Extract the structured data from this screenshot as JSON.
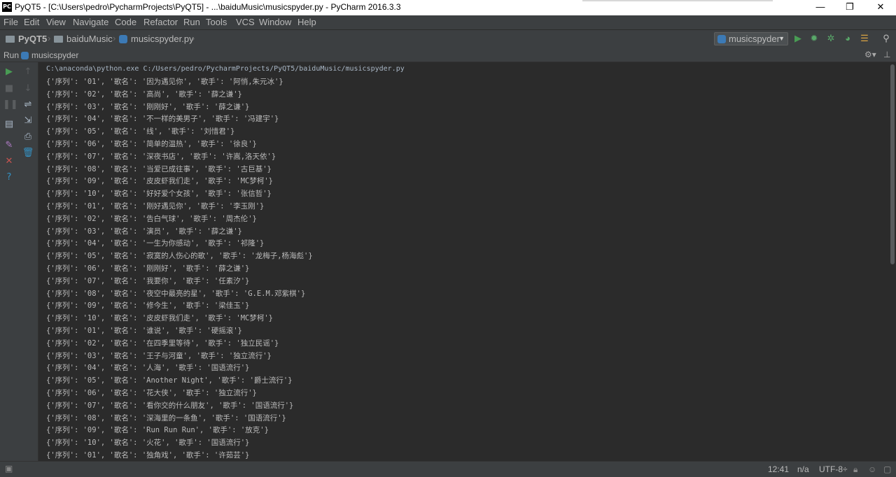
{
  "window": {
    "title": "PyQT5 - [C:\\Users\\pedro\\PycharmProjects\\PyQT5] - ...\\baiduMusic\\musicspyder.py - PyCharm 2016.3.3",
    "app_icon_text": "PC",
    "minimize": "—",
    "restore": "❐",
    "close": "✕"
  },
  "menu": [
    "File",
    "Edit",
    "View",
    "Navigate",
    "Code",
    "Refactor",
    "Run",
    "Tools",
    "VCS",
    "Window",
    "Help"
  ],
  "breadcrumb": {
    "project": "PyQT5",
    "folder": "baiduMusic",
    "file": "musicspyder.py"
  },
  "run_config": "musicspyder",
  "run_panel": {
    "label": "Run",
    "tab": "musicspyder"
  },
  "console": {
    "command": "C:\\anaconda\\python.exe C:/Users/pedro/PycharmProjects/PyQT5/baiduMusic/musicspyder.py",
    "lines": [
      "{'序列': '01', '歌名': '因为遇见你', '歌手': '阿悄,朱元冰'}",
      "{'序列': '02', '歌名': '高尚', '歌手': '薛之谦'}",
      "{'序列': '03', '歌名': '刚刚好', '歌手': '薛之谦'}",
      "{'序列': '04', '歌名': '不一样的美男子', '歌手': '冯建宇'}",
      "{'序列': '05', '歌名': '线', '歌手': '刘惜君'}",
      "{'序列': '06', '歌名': '简单的温热', '歌手': '徐良'}",
      "{'序列': '07', '歌名': '深夜书店', '歌手': '许嵩,洛天依'}",
      "{'序列': '08', '歌名': '当爱已成往事', '歌手': '古巨基'}",
      "{'序列': '09', '歌名': '皮皮虾我们走', '歌手': 'MC梦柯'}",
      "{'序列': '10', '歌名': '好好爱个女孩', '歌手': '张信哲'}",
      "{'序列': '01', '歌名': '刚好遇见你', '歌手': '李玉刚'}",
      "{'序列': '02', '歌名': '告白气球', '歌手': '周杰伦'}",
      "{'序列': '03', '歌名': '演员', '歌手': '薛之谦'}",
      "{'序列': '04', '歌名': '一生为你感动', '歌手': '祁隆'}",
      "{'序列': '05', '歌名': '寂寞的人伤心的歌', '歌手': '龙梅子,杨海彪'}",
      "{'序列': '06', '歌名': '刚刚好', '歌手': '薛之谦'}",
      "{'序列': '07', '歌名': '我要你', '歌手': '任素汐'}",
      "{'序列': '08', '歌名': '夜空中最亮的星', '歌手': 'G.E.M.邓紫棋'}",
      "{'序列': '09', '歌名': '修今生', '歌手': '梁佳玉'}",
      "{'序列': '10', '歌名': '皮皮虾我们走', '歌手': 'MC梦柯'}",
      "{'序列': '01', '歌名': '谁说', '歌手': '硬摇滚'}",
      "{'序列': '02', '歌名': '在四季里等待', '歌手': '独立民谣'}",
      "{'序列': '03', '歌名': '王子与河童', '歌手': '独立流行'}",
      "{'序列': '04', '歌名': '人海', '歌手': '国语流行'}",
      "{'序列': '05', '歌名': 'Another Night', '歌手': '爵士流行'}",
      "{'序列': '06', '歌名': '花大侠', '歌手': '独立流行'}",
      "{'序列': '07', '歌名': '看你交的什么朋友', '歌手': '国语流行'}",
      "{'序列': '08', '歌名': '深海里的一条鱼', '歌手': '国语流行'}",
      "{'序列': '09', '歌名': 'Run Run Run', '歌手': '放克'}",
      "{'序列': '10', '歌名': '火花', '歌手': '国语流行'}",
      "{'序列': '01', '歌名': '独角戏', '歌手': '许茹芸'}"
    ]
  },
  "status": {
    "position": "12:41",
    "line_sep": "n/a",
    "encoding": "UTF-8÷"
  },
  "colors": {
    "run_green": "#499c54",
    "debug_green": "#59a869",
    "stop_red": "#c75450",
    "help_blue": "#3592c4"
  }
}
